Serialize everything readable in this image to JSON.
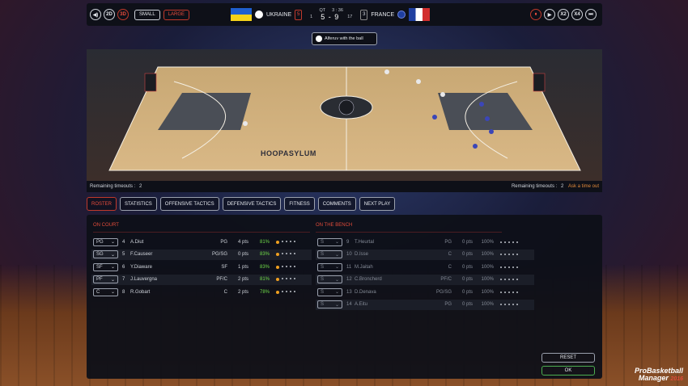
{
  "topbar": {
    "left_buttons": [
      "◀)",
      "2D",
      "3D"
    ],
    "size_small": "SMALL",
    "size_large": "LARGE",
    "home": {
      "name": "UKRAINE",
      "fouls": "5",
      "timeouts": "1"
    },
    "away": {
      "name": "FRANCE",
      "fouls": "3",
      "timeouts": "17"
    },
    "quarter_label": "QT",
    "clock": "3 : 36",
    "score": "5 - 9",
    "right_buttons": [
      "⏸",
      "▶",
      "X2",
      "X4",
      "⏭"
    ]
  },
  "possession": "Alferuv with the ball",
  "court": {
    "banner": "HOOPASYLUM"
  },
  "timeouts": {
    "left_label": "Remaining timeouts :",
    "left_value": "2",
    "right_label": "Remaining timeouts :",
    "right_value": "2",
    "ask": "Ask a time out"
  },
  "tabs": [
    "ROSTER",
    "STATISTICS",
    "OFFENSIVE TACTICS",
    "DEFENSIVE TACTICS",
    "FITNESS",
    "COMMENTS",
    "NEXT PLAY"
  ],
  "on_court": {
    "title": "ON COURT",
    "players": [
      {
        "slot": "PG",
        "num": "4",
        "name": "A.Diut",
        "pos": "PG",
        "pts": "4 pts",
        "fit": "81%"
      },
      {
        "slot": "SG",
        "num": "5",
        "name": "F.Causeer",
        "pos": "PG/SG",
        "pts": "0 pts",
        "fit": "83%"
      },
      {
        "slot": "SF",
        "num": "6",
        "name": "Y.Diaware",
        "pos": "SF",
        "pts": "1 pts",
        "fit": "83%"
      },
      {
        "slot": "PF",
        "num": "7",
        "name": "J.Lauvergna",
        "pos": "PF/C",
        "pts": "2 pts",
        "fit": "81%"
      },
      {
        "slot": "C",
        "num": "8",
        "name": "R.Gobart",
        "pos": "C",
        "pts": "2 pts",
        "fit": "78%"
      }
    ]
  },
  "bench": {
    "title": "ON THE BENCH",
    "players": [
      {
        "slot": "S",
        "num": "9",
        "name": "T.Heurtal",
        "pos": "PG",
        "pts": "0 pts",
        "fit": "100%"
      },
      {
        "slot": "S",
        "num": "10",
        "name": "D.Isse",
        "pos": "C",
        "pts": "0 pts",
        "fit": "100%"
      },
      {
        "slot": "S",
        "num": "11",
        "name": "M.Jaitah",
        "pos": "C",
        "pts": "0 pts",
        "fit": "100%"
      },
      {
        "slot": "S",
        "num": "12",
        "name": "C.Broncherd",
        "pos": "PF/C",
        "pts": "0 pts",
        "fit": "100%"
      },
      {
        "slot": "S",
        "num": "13",
        "name": "D.Denava",
        "pos": "PG/SG",
        "pts": "0 pts",
        "fit": "100%"
      },
      {
        "slot": "S",
        "num": "14",
        "name": "A.Eitu",
        "pos": "PG",
        "pts": "0 pts",
        "fit": "100%"
      }
    ]
  },
  "actions": {
    "reset": "RESET",
    "ok": "OK"
  },
  "brand": {
    "line1": "ProBasketball",
    "line2": "Manager",
    "year": "2016"
  },
  "colors": {
    "accent": "#e04b3a",
    "fitness_green": "#6fdc48",
    "ok_border": "#4caf50"
  }
}
